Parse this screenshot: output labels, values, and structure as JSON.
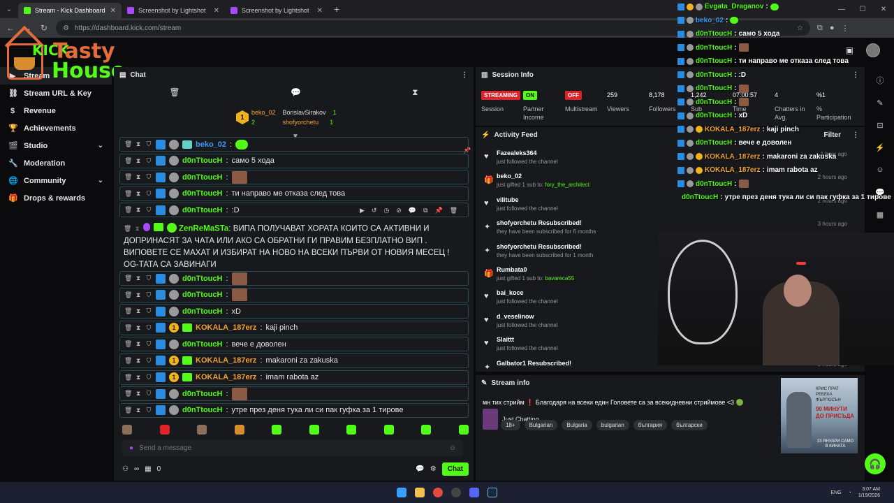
{
  "browser": {
    "tabs": [
      {
        "label": "Stream - Kick Dashboard",
        "active": true,
        "icon_color": "#53fc18"
      },
      {
        "label": "Screenshot by Lightshot",
        "active": false,
        "icon_color": "#a64bfb"
      },
      {
        "label": "Screenshot by Lightshot",
        "active": false,
        "icon_color": "#a64bfb"
      }
    ],
    "url": "https://dashboard.kick.com/stream"
  },
  "logo": {
    "kick": "KICK",
    "tasty": "Tasty",
    "house": "House"
  },
  "sidebar": {
    "items": [
      {
        "label": "Stream",
        "icon": "video-icon",
        "active": true,
        "chevron": false
      },
      {
        "label": "Stream URL & Key",
        "icon": "link-icon",
        "active": false,
        "chevron": false
      },
      {
        "label": "Revenue",
        "icon": "dollar-icon",
        "active": false,
        "chevron": false
      },
      {
        "label": "Achievements",
        "icon": "trophy-icon",
        "active": false,
        "chevron": false
      },
      {
        "label": "Studio",
        "icon": "film-icon",
        "active": false,
        "chevron": true
      },
      {
        "label": "Moderation",
        "icon": "wrench-icon",
        "active": false,
        "chevron": false
      },
      {
        "label": "Community",
        "icon": "globe-icon",
        "active": false,
        "chevron": true
      },
      {
        "label": "Drops & rewards",
        "icon": "gift-icon",
        "active": false,
        "chevron": false
      }
    ]
  },
  "chat": {
    "title": "Chat",
    "gifters": {
      "top_name": "beko_02",
      "top_rank": "1",
      "top_count": "2",
      "col2": [
        {
          "name": "BorislavSirakov",
          "count": "1"
        },
        {
          "name": "shofyorchetu",
          "count": "1"
        }
      ]
    },
    "messages": [
      {
        "user": "beko_02",
        "color": "#3e9cff",
        "badge": "teal",
        "text": "",
        "emote": "green"
      },
      {
        "user": "d0nTtoucH",
        "color": "#53fc18",
        "badge": "gray",
        "text": "само 5 хода",
        "emote": ""
      },
      {
        "user": "d0nTtoucH",
        "color": "#53fc18",
        "badge": "gray",
        "text": "",
        "emote": "face"
      },
      {
        "user": "d0nTtoucH",
        "color": "#53fc18",
        "badge": "gray",
        "text": "ти направо ме отказа след това",
        "emote": ""
      },
      {
        "user": "d0nTtoucH",
        "color": "#53fc18",
        "badge": "gray",
        "text": ":D",
        "emote": ""
      }
    ],
    "long_message": {
      "user": "ZenReMaSTa",
      "text": "ВИПА ПОЛУЧАВАТ ХОРАТА КОИТО СА АКТИВНИ И ДОПРИНАСЯТ ЗА ЧАТА ИЛИ АКО СА ОБРАТНИ ГИ ПРАВИМ БЕЗПЛАТНО ВИП . ВИПОВЕТЕ СЕ МАХАТ И ИЗБИРАТ НА НОВО НА ВСЕКИ ПЪРВИ ОТ НОВИЯ МЕСЕЦ ! OG-ТАТА СА ЗАВИНАГИ"
    },
    "messages2": [
      {
        "user": "d0nTtoucH",
        "color": "#53fc18",
        "badge": "gray",
        "text": "",
        "emote": "face"
      },
      {
        "user": "d0nTtoucH",
        "color": "#53fc18",
        "badge": "gray",
        "text": "",
        "emote": "face"
      },
      {
        "user": "d0nTtoucH",
        "color": "#53fc18",
        "badge": "gray",
        "text": "xD",
        "emote": ""
      },
      {
        "user": "KOKALA_187erz",
        "color": "#f4a236",
        "badge": "gold",
        "text": "kaji pinch",
        "emote": ""
      },
      {
        "user": "d0nTtoucH",
        "color": "#53fc18",
        "badge": "gray",
        "text": "вече е доволен",
        "emote": ""
      },
      {
        "user": "KOKALA_187erz",
        "color": "#f4a236",
        "badge": "gold",
        "text": "makaroni za zakuska",
        "emote": ""
      },
      {
        "user": "KOKALA_187erz",
        "color": "#f4a236",
        "badge": "gold",
        "text": "imam rabota az",
        "emote": ""
      },
      {
        "user": "d0nTtoucH",
        "color": "#53fc18",
        "badge": "gray",
        "text": "",
        "emote": "face"
      },
      {
        "user": "d0nTtoucH",
        "color": "#53fc18",
        "badge": "gray",
        "text": "утре през деня тука ли си пак гуфка за 1 тирове",
        "emote": ""
      }
    ],
    "send_placeholder": "Send a message",
    "footer": {
      "infinity": "∞",
      "count": "0",
      "chat_button": "Chat"
    }
  },
  "session": {
    "title": "Session Info",
    "stats": [
      {
        "value": "STREAMING",
        "type": "red",
        "label": "Session"
      },
      {
        "value": "ON",
        "type": "green",
        "label": "Partner Income"
      },
      {
        "value": "OFF",
        "type": "red",
        "label": "Multistream"
      },
      {
        "value": "259",
        "type": "plain",
        "label": "Viewers"
      },
      {
        "value": "8,178",
        "type": "plain",
        "label": "Followers"
      },
      {
        "value": "1,242",
        "type": "plain",
        "label": "Sub"
      },
      {
        "value": "07:00:57",
        "type": "plain",
        "label": "Time"
      },
      {
        "value": "4",
        "type": "plain",
        "label": "Chatters in Avg."
      },
      {
        "value": "%1",
        "type": "plain",
        "label": "% Participation"
      }
    ]
  },
  "activity": {
    "title": "Activity Feed",
    "filter": "Filter",
    "items": [
      {
        "icon": "heart-icon",
        "name": "Fazealeks364",
        "desc": "just followed the channel",
        "hl": "",
        "time": "1 hour ago"
      },
      {
        "icon": "gift-icon",
        "name": "beko_02",
        "desc": "just gifted 1 sub to: ",
        "hl": "fory_the_architect",
        "time": "2 hours ago"
      },
      {
        "icon": "heart-icon",
        "name": "vilitube",
        "desc": "just followed the channel",
        "hl": "",
        "time": "2 hours ago"
      },
      {
        "icon": "star-icon",
        "name": "shofyorchetu Resubscribed!",
        "desc": "they have been subscribed for 6 months",
        "hl": "",
        "time": "3 hours ago"
      },
      {
        "icon": "star-icon",
        "name": "shofyorchetu Resubscribed!",
        "desc": "they have been subscribed for 1 month",
        "hl": "",
        "time": ""
      },
      {
        "icon": "gift-icon",
        "name": "Rumbata0",
        "desc": "just gifted 1 sub to: ",
        "hl": "bavareca55",
        "time": ""
      },
      {
        "icon": "heart-icon",
        "name": "bai_koce",
        "desc": "just followed the channel",
        "hl": "",
        "time": ""
      },
      {
        "icon": "heart-icon",
        "name": "d_veselinow",
        "desc": "just followed the channel",
        "hl": "",
        "time": ""
      },
      {
        "icon": "heart-icon",
        "name": "Slaittt",
        "desc": "just followed the channel",
        "hl": "",
        "time": ""
      },
      {
        "icon": "star-icon",
        "name": "Galbator1 Resubscribed!",
        "desc": "",
        "hl": "",
        "time": "5 hours ago"
      }
    ]
  },
  "streaminfo": {
    "title": "Stream info",
    "stream_title": "мн тих стрийм ❗ Благодаря на всеки един Головете са за всекидневни стриймове <3 🟢",
    "category": "Just Chatting",
    "tags": [
      "18+",
      "Bulgarian",
      "Bulgaria",
      "bulgarian",
      "българия",
      "български"
    ],
    "poster": {
      "top": "КРИС ПРАТ РЕБЕКА ФЪРГЮСЪН",
      "mid": "90 МИНУТИ ДО ПРИСЪДА",
      "bot": "23 ЯНУАРИ САМО В КИНАТА"
    }
  },
  "overlay": [
    {
      "user": "Evgata_Draganov",
      "color": "#53fc18",
      "badges": [
        "blue",
        "gold",
        "gray"
      ],
      "text": "",
      "emote": "green"
    },
    {
      "user": "beko_02",
      "color": "#3e9cff",
      "badges": [
        "blue",
        "gray"
      ],
      "text": "",
      "emote": "green"
    },
    {
      "user": "d0nTtoucH",
      "color": "#53fc18",
      "badges": [
        "blue",
        "gray"
      ],
      "text": "само 5 хода",
      "emote": ""
    },
    {
      "user": "d0nTtoucH",
      "color": "#53fc18",
      "badges": [
        "blue",
        "gray"
      ],
      "text": "",
      "emote": "face"
    },
    {
      "user": "d0nTtoucH",
      "color": "#53fc18",
      "badges": [
        "blue",
        "gray"
      ],
      "text": "ти направо ме отказа след това",
      "emote": ""
    },
    {
      "user": "d0nTtoucH",
      "color": "#53fc18",
      "badges": [
        "blue",
        "gray"
      ],
      "text": ":D",
      "emote": ""
    },
    {
      "user": "d0nTtoucH",
      "color": "#53fc18",
      "badges": [
        "blue",
        "gray"
      ],
      "text": "",
      "emote": "face"
    },
    {
      "user": "d0nTtoucH",
      "color": "#53fc18",
      "badges": [
        "blue",
        "gray"
      ],
      "text": "",
      "emote": "face"
    },
    {
      "user": "d0nTtoucH",
      "color": "#53fc18",
      "badges": [
        "blue",
        "gray"
      ],
      "text": "xD",
      "emote": ""
    },
    {
      "user": "KOKALA_187erz",
      "color": "#f4a236",
      "badges": [
        "blue",
        "gray",
        "gold"
      ],
      "text": "kaji pinch",
      "emote": ""
    },
    {
      "user": "d0nTtoucH",
      "color": "#53fc18",
      "badges": [
        "blue",
        "gray"
      ],
      "text": "вече е доволен",
      "emote": ""
    },
    {
      "user": "KOKALA_187erz",
      "color": "#f4a236",
      "badges": [
        "blue",
        "gray",
        "gold"
      ],
      "text": "makaroni za zakuska",
      "emote": ""
    },
    {
      "user": "KOKALA_187erz",
      "color": "#f4a236",
      "badges": [
        "blue",
        "gray",
        "gold"
      ],
      "text": "imam rabota az",
      "emote": ""
    },
    {
      "user": "d0nTtoucH",
      "color": "#53fc18",
      "badges": [
        "blue",
        "gray"
      ],
      "text": "",
      "emote": "face"
    },
    {
      "user": "d0nTtoucH",
      "color": "#53fc18",
      "badges": [
        "blue",
        "gray"
      ],
      "text": "утре през деня тука ли си пак гуфка за 1 тирове",
      "emote": ""
    }
  ],
  "taskbar": {
    "lang": "ENG",
    "time": "3:07 AM",
    "date": "1/19/2026"
  },
  "colors": {
    "kick_green": "#53fc18",
    "accent_red": "#e0222a",
    "panel": "#18191c"
  }
}
